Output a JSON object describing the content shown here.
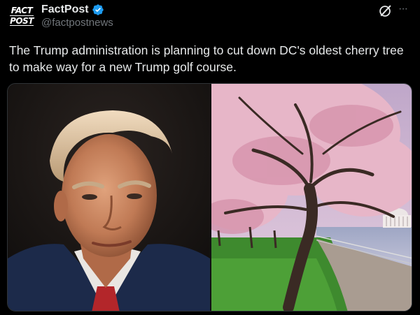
{
  "post": {
    "account": {
      "display_name": "FactPost",
      "handle": "@factpostnews",
      "verified": true,
      "avatar_text": [
        "FACT",
        "POST"
      ]
    },
    "text": "The Trump administration is planning to cut down DC's oldest cherry tree to make way for a new Trump golf course.",
    "media": [
      {
        "subject": "portrait-photo"
      },
      {
        "subject": "cherry-tree-photo"
      }
    ],
    "actions": {
      "grok": "grok-icon",
      "more": "···"
    }
  },
  "colors": {
    "background": "#000000",
    "text": "#e7e9ea",
    "secondary": "#71767b",
    "verified": "#1d9bf0"
  }
}
